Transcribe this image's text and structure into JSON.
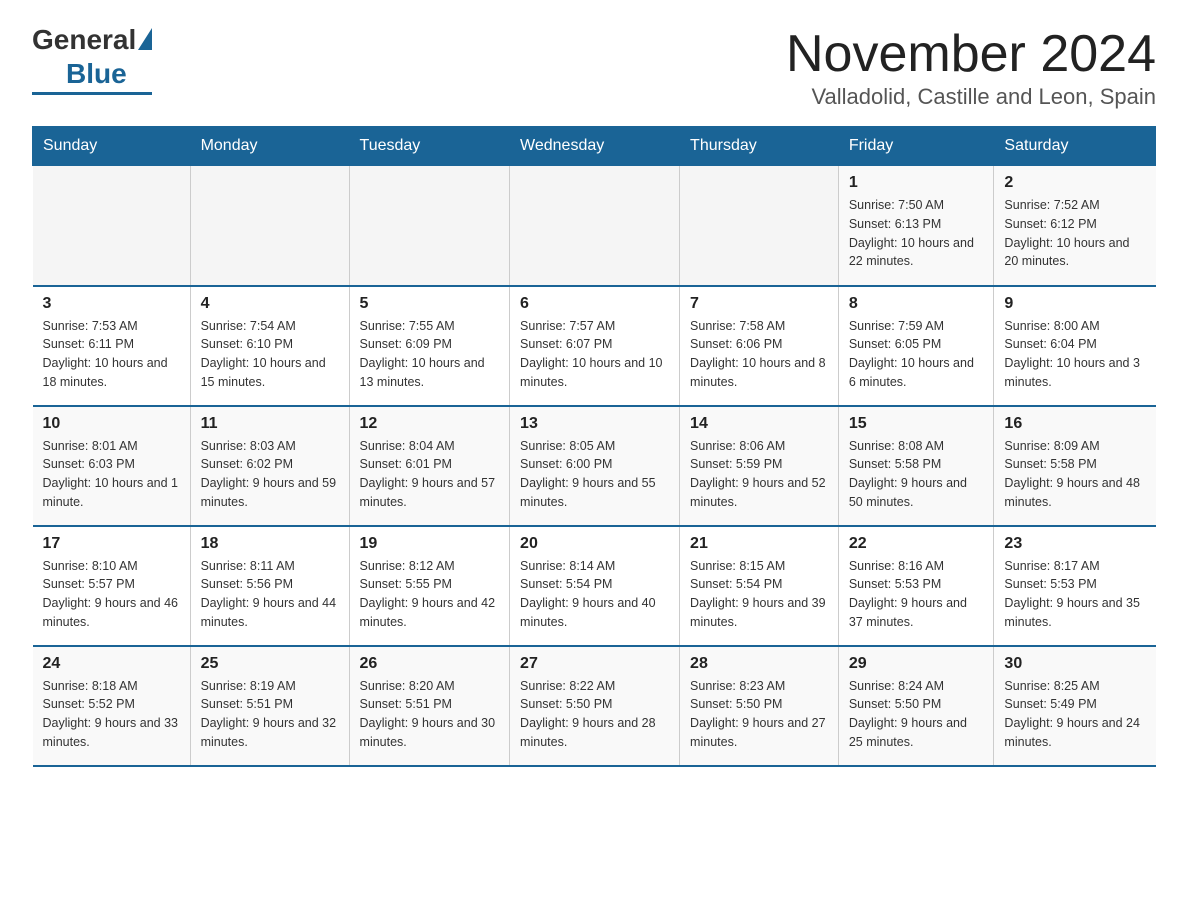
{
  "logo": {
    "general": "General",
    "blue": "Blue"
  },
  "header": {
    "month_year": "November 2024",
    "location": "Valladolid, Castille and Leon, Spain"
  },
  "days_of_week": [
    "Sunday",
    "Monday",
    "Tuesday",
    "Wednesday",
    "Thursday",
    "Friday",
    "Saturday"
  ],
  "weeks": [
    [
      {
        "day": "",
        "info": ""
      },
      {
        "day": "",
        "info": ""
      },
      {
        "day": "",
        "info": ""
      },
      {
        "day": "",
        "info": ""
      },
      {
        "day": "",
        "info": ""
      },
      {
        "day": "1",
        "info": "Sunrise: 7:50 AM\nSunset: 6:13 PM\nDaylight: 10 hours and 22 minutes."
      },
      {
        "day": "2",
        "info": "Sunrise: 7:52 AM\nSunset: 6:12 PM\nDaylight: 10 hours and 20 minutes."
      }
    ],
    [
      {
        "day": "3",
        "info": "Sunrise: 7:53 AM\nSunset: 6:11 PM\nDaylight: 10 hours and 18 minutes."
      },
      {
        "day": "4",
        "info": "Sunrise: 7:54 AM\nSunset: 6:10 PM\nDaylight: 10 hours and 15 minutes."
      },
      {
        "day": "5",
        "info": "Sunrise: 7:55 AM\nSunset: 6:09 PM\nDaylight: 10 hours and 13 minutes."
      },
      {
        "day": "6",
        "info": "Sunrise: 7:57 AM\nSunset: 6:07 PM\nDaylight: 10 hours and 10 minutes."
      },
      {
        "day": "7",
        "info": "Sunrise: 7:58 AM\nSunset: 6:06 PM\nDaylight: 10 hours and 8 minutes."
      },
      {
        "day": "8",
        "info": "Sunrise: 7:59 AM\nSunset: 6:05 PM\nDaylight: 10 hours and 6 minutes."
      },
      {
        "day": "9",
        "info": "Sunrise: 8:00 AM\nSunset: 6:04 PM\nDaylight: 10 hours and 3 minutes."
      }
    ],
    [
      {
        "day": "10",
        "info": "Sunrise: 8:01 AM\nSunset: 6:03 PM\nDaylight: 10 hours and 1 minute."
      },
      {
        "day": "11",
        "info": "Sunrise: 8:03 AM\nSunset: 6:02 PM\nDaylight: 9 hours and 59 minutes."
      },
      {
        "day": "12",
        "info": "Sunrise: 8:04 AM\nSunset: 6:01 PM\nDaylight: 9 hours and 57 minutes."
      },
      {
        "day": "13",
        "info": "Sunrise: 8:05 AM\nSunset: 6:00 PM\nDaylight: 9 hours and 55 minutes."
      },
      {
        "day": "14",
        "info": "Sunrise: 8:06 AM\nSunset: 5:59 PM\nDaylight: 9 hours and 52 minutes."
      },
      {
        "day": "15",
        "info": "Sunrise: 8:08 AM\nSunset: 5:58 PM\nDaylight: 9 hours and 50 minutes."
      },
      {
        "day": "16",
        "info": "Sunrise: 8:09 AM\nSunset: 5:58 PM\nDaylight: 9 hours and 48 minutes."
      }
    ],
    [
      {
        "day": "17",
        "info": "Sunrise: 8:10 AM\nSunset: 5:57 PM\nDaylight: 9 hours and 46 minutes."
      },
      {
        "day": "18",
        "info": "Sunrise: 8:11 AM\nSunset: 5:56 PM\nDaylight: 9 hours and 44 minutes."
      },
      {
        "day": "19",
        "info": "Sunrise: 8:12 AM\nSunset: 5:55 PM\nDaylight: 9 hours and 42 minutes."
      },
      {
        "day": "20",
        "info": "Sunrise: 8:14 AM\nSunset: 5:54 PM\nDaylight: 9 hours and 40 minutes."
      },
      {
        "day": "21",
        "info": "Sunrise: 8:15 AM\nSunset: 5:54 PM\nDaylight: 9 hours and 39 minutes."
      },
      {
        "day": "22",
        "info": "Sunrise: 8:16 AM\nSunset: 5:53 PM\nDaylight: 9 hours and 37 minutes."
      },
      {
        "day": "23",
        "info": "Sunrise: 8:17 AM\nSunset: 5:53 PM\nDaylight: 9 hours and 35 minutes."
      }
    ],
    [
      {
        "day": "24",
        "info": "Sunrise: 8:18 AM\nSunset: 5:52 PM\nDaylight: 9 hours and 33 minutes."
      },
      {
        "day": "25",
        "info": "Sunrise: 8:19 AM\nSunset: 5:51 PM\nDaylight: 9 hours and 32 minutes."
      },
      {
        "day": "26",
        "info": "Sunrise: 8:20 AM\nSunset: 5:51 PM\nDaylight: 9 hours and 30 minutes."
      },
      {
        "day": "27",
        "info": "Sunrise: 8:22 AM\nSunset: 5:50 PM\nDaylight: 9 hours and 28 minutes."
      },
      {
        "day": "28",
        "info": "Sunrise: 8:23 AM\nSunset: 5:50 PM\nDaylight: 9 hours and 27 minutes."
      },
      {
        "day": "29",
        "info": "Sunrise: 8:24 AM\nSunset: 5:50 PM\nDaylight: 9 hours and 25 minutes."
      },
      {
        "day": "30",
        "info": "Sunrise: 8:25 AM\nSunset: 5:49 PM\nDaylight: 9 hours and 24 minutes."
      }
    ]
  ]
}
